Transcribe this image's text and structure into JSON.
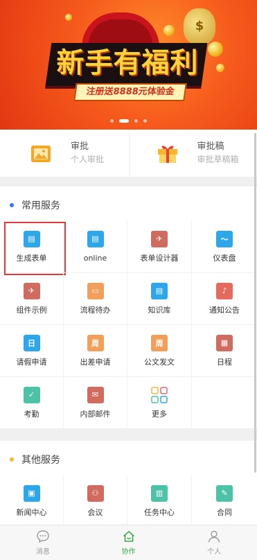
{
  "banner": {
    "headline": "新手有福利",
    "sub": "注册送8888元体验金",
    "bag_symbol": "$",
    "slides": 4,
    "active_slide": 1
  },
  "approve": [
    {
      "title": "审批",
      "subtitle": "个人审批",
      "icon": "picture-icon",
      "color": "#f5a623"
    },
    {
      "title": "审批稿",
      "subtitle": "审批草稿箱",
      "icon": "gift-icon",
      "color": "#f7b52c"
    }
  ],
  "sections": {
    "common": {
      "title": "常用服务",
      "bullet_color": "#2a7be4",
      "items": [
        {
          "label": "生成表单",
          "icon": "form-icon",
          "color": "#2ea7e8",
          "glyph": "▤"
        },
        {
          "label": "online",
          "icon": "document-icon",
          "color": "#2ea7e8",
          "glyph": "▤"
        },
        {
          "label": "表单设计器",
          "icon": "airplane-icon",
          "color": "#cf6b5f",
          "glyph": "✈"
        },
        {
          "label": "仪表盘",
          "icon": "monitor-icon",
          "color": "#2ea7e8",
          "glyph": "〜"
        },
        {
          "label": "组件示例",
          "icon": "airplane-icon",
          "color": "#cf6b5f",
          "glyph": "✈"
        },
        {
          "label": "流程待办",
          "icon": "briefcase-icon",
          "color": "#f0a05a",
          "glyph": "▭"
        },
        {
          "label": "知识库",
          "icon": "book-icon",
          "color": "#2ea7e8",
          "glyph": "▤"
        },
        {
          "label": "通知公告",
          "icon": "bell-icon",
          "color": "#e36a5c",
          "glyph": "♪"
        },
        {
          "label": "请假申请",
          "icon": "calendar-day-icon",
          "color": "#2ea7e8",
          "glyph": "日"
        },
        {
          "label": "出差申请",
          "icon": "calendar-week-icon",
          "color": "#f0a05a",
          "glyph": "周"
        },
        {
          "label": "公文发文",
          "icon": "calendar-week-icon",
          "color": "#f0a05a",
          "glyph": "周"
        },
        {
          "label": "日程",
          "icon": "calendar-icon",
          "color": "#cf6b5f",
          "glyph": "▦"
        },
        {
          "label": "考勤",
          "icon": "calendar-check-icon",
          "color": "#4dc2a6",
          "glyph": "✓"
        },
        {
          "label": "内部邮件",
          "icon": "mail-icon",
          "color": "#cf6b5f",
          "glyph": "✉"
        },
        {
          "label": "更多",
          "icon": "more-grid-icon",
          "color": "#ffffff",
          "glyph": ""
        },
        {
          "label": "",
          "icon": "",
          "color": "#ffffff",
          "glyph": ""
        }
      ]
    },
    "other": {
      "title": "其他服务",
      "bullet_color": "#f5b82e",
      "items": [
        {
          "label": "新闻中心",
          "icon": "news-icon",
          "color": "#2ea7e8",
          "glyph": "▣"
        },
        {
          "label": "会议",
          "icon": "meeting-icon",
          "color": "#cf6b5f",
          "glyph": "⚇"
        },
        {
          "label": "任务中心",
          "icon": "clipboard-icon",
          "color": "#4dc2a6",
          "glyph": "▥"
        },
        {
          "label": "合同",
          "icon": "contract-icon",
          "color": "#4dc2a6",
          "glyph": "✎"
        }
      ]
    }
  },
  "tabs": [
    {
      "label": "消息",
      "icon": "message-icon",
      "active": false
    },
    {
      "label": "协作",
      "icon": "home-icon",
      "active": true
    },
    {
      "label": "个人",
      "icon": "person-icon",
      "active": false
    }
  ]
}
